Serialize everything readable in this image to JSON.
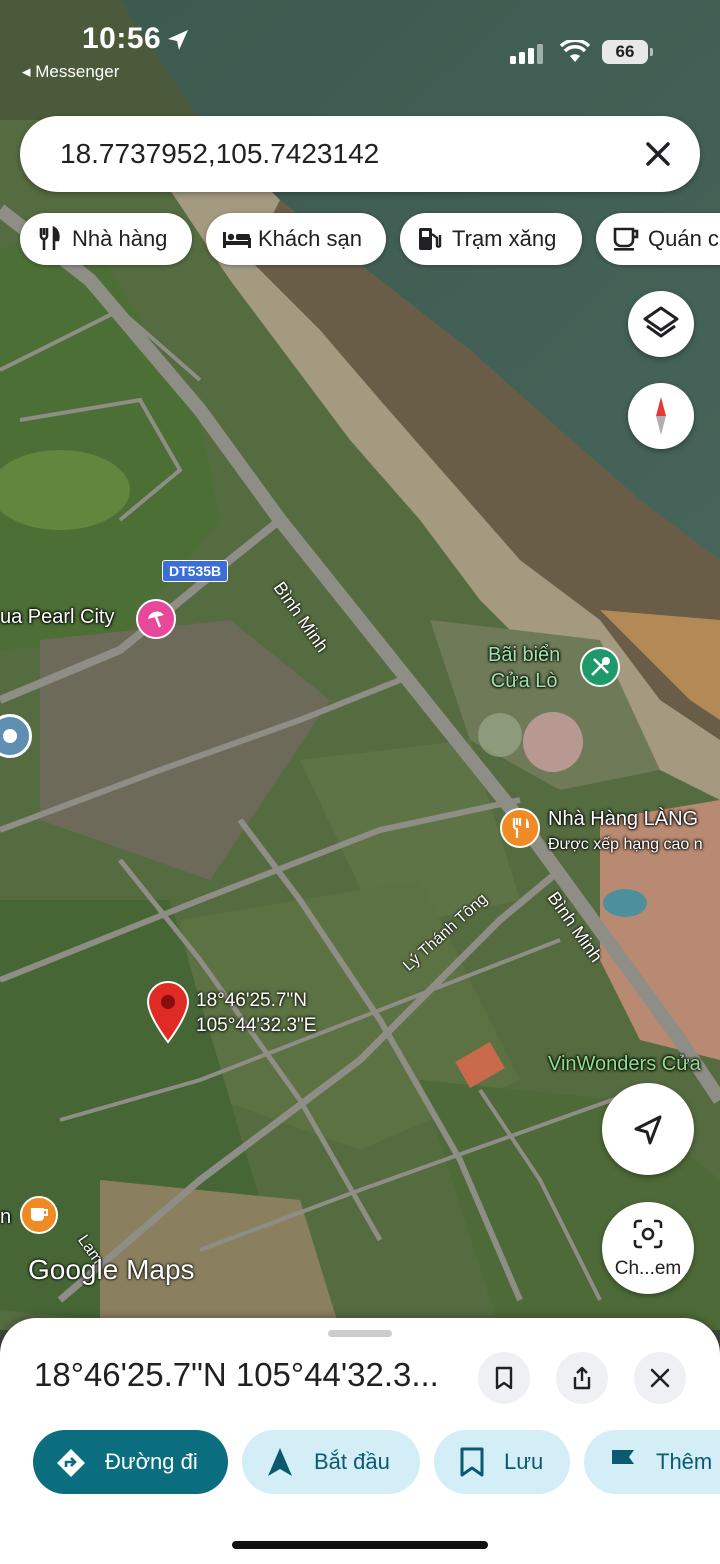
{
  "status_bar": {
    "time": "10:56",
    "back_app": "◂ Messenger",
    "battery": "66"
  },
  "search": {
    "query": "18.7737952,105.7423142"
  },
  "chips": [
    {
      "label": "Nhà hàng",
      "icon": "restaurant-icon"
    },
    {
      "label": "Khách sạn",
      "icon": "hotel-icon"
    },
    {
      "label": "Trạm xăng",
      "icon": "gas-station-icon"
    },
    {
      "label": "Quán c",
      "icon": "coffee-icon"
    }
  ],
  "map": {
    "road_labels": [
      "Bình Minh",
      "Bình Minh",
      "Lý Thánh Tông",
      "Lam"
    ],
    "highway_shield": "DT535B",
    "pois": [
      {
        "name": "ua Pearl City",
        "color": "#e8489a"
      },
      {
        "name_line1": "Bãi biển",
        "name_line2": "Cửa Lò",
        "color": "#1e9a6a"
      },
      {
        "name": "Nhà Hàng LÀNG",
        "subtitle": "Được xếp hạng cao n",
        "color": "#f08a24"
      },
      {
        "name": "VinWonders Cửa",
        "color": "#3cba54"
      },
      {
        "name": "n",
        "color": "#f08a24"
      }
    ],
    "pin_label_line1": "18°46'25.7\"N",
    "pin_label_line2": "105°44'32.3\"E",
    "logo": "Google Maps",
    "layers_icon": "layers-icon",
    "compass_icon": "compass-icon",
    "locate_icon": "navigation-arrow-icon",
    "lens_label": "Ch...em"
  },
  "sheet": {
    "title": "18°46'25.7\"N 105°44'32.3...",
    "actions": [
      {
        "label": "Đường đi",
        "icon": "directions-icon",
        "primary": true
      },
      {
        "label": "Bắt đầu",
        "icon": "navigate-icon"
      },
      {
        "label": "Lưu",
        "icon": "bookmark-icon"
      },
      {
        "label": "Thêm",
        "icon": "flag-icon"
      }
    ]
  },
  "colors": {
    "primary_button": "#0b6e7f",
    "secondary_button": "#d3eef6",
    "accent_text": "#0b5a70"
  }
}
